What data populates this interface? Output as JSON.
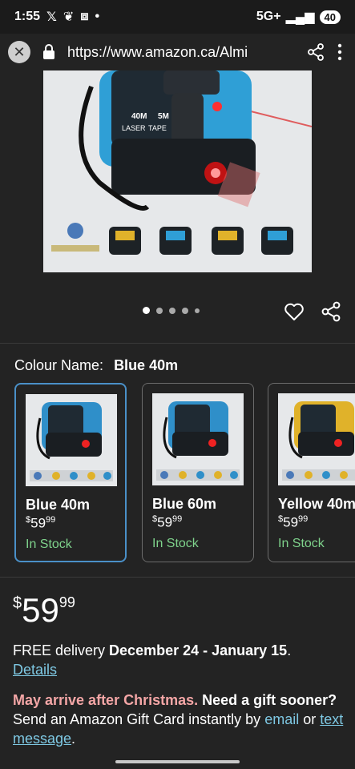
{
  "status": {
    "time": "1:55",
    "network": "5G+",
    "battery": "40"
  },
  "browser": {
    "url": "https://www.amazon.ca/Almi"
  },
  "product": {
    "colour_label": "Colour Name:",
    "colour_value": "Blue 40m",
    "image_text": {
      "laser": "LASER",
      "tape": "TAPE",
      "laser_range": "40M",
      "tape_range": "5M"
    }
  },
  "swatches": [
    {
      "name": "Blue 40m",
      "price_dollars": "59",
      "price_cents": "99",
      "currency": "$",
      "stock": "In Stock",
      "color": "#2f8fc9"
    },
    {
      "name": "Blue 60m",
      "price_dollars": "59",
      "price_cents": "99",
      "currency": "$",
      "stock": "In Stock",
      "color": "#2f8fc9"
    },
    {
      "name": "Yellow 40m",
      "price_dollars": "59",
      "price_cents": "99",
      "currency": "$",
      "stock": "In Stock",
      "color": "#e0b22a"
    }
  ],
  "price": {
    "currency": "$",
    "dollars": "59",
    "cents": "99"
  },
  "delivery": {
    "prefix": "FREE delivery",
    "dates": "December 24 - January 15",
    "suffix": ".",
    "details": "Details"
  },
  "gift": {
    "warning": "May arrive after Christmas.",
    "sooner": "Need a gift sooner?",
    "send": "Send an Amazon Gift Card instantly by",
    "email": "email",
    "or": "or",
    "text_message": "text message",
    "end": "."
  },
  "colors": {
    "accent_link": "#7ec8e3",
    "in_stock": "#7fd38c",
    "warning": "#f4a6a6",
    "selected_border": "#4a90c8"
  }
}
